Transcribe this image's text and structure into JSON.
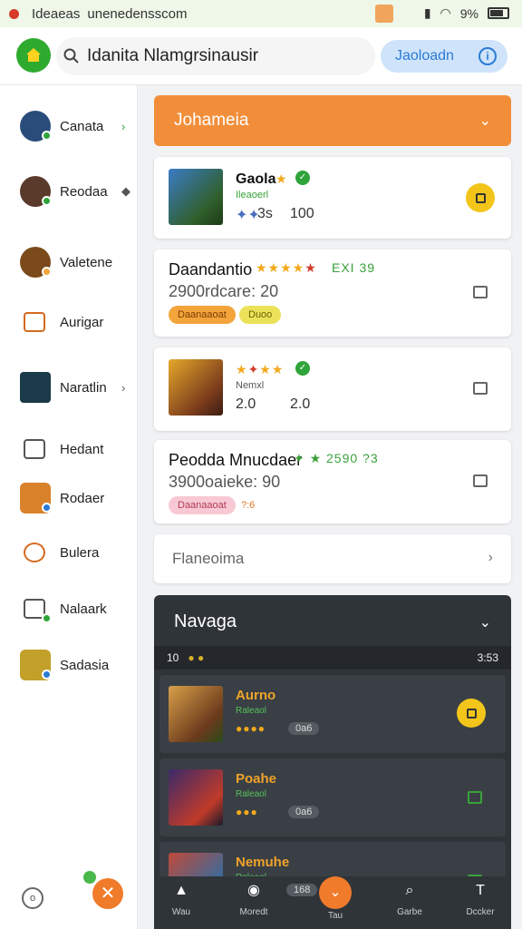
{
  "status_bar": {
    "left_text_1": "Ideaeas",
    "left_text_2": "unenedensscom",
    "right_text": "9%"
  },
  "top_bar": {
    "search_text": "Idanita Nlamgrsinausir",
    "pill_label": "Jaoloadn",
    "info_label": "i"
  },
  "sidebar": {
    "items": [
      {
        "label": "Canata",
        "has_chevron": true,
        "badge_color": "#2fa43a"
      },
      {
        "label": "Reodaa",
        "has_chevron": true,
        "badge_color": "#2fa43a"
      },
      {
        "label": "Valetene",
        "has_chevron": false,
        "badge_color": "#f3a43b"
      },
      {
        "label": "Aurigar",
        "has_chevron": false
      },
      {
        "label": "Naratlin",
        "has_chevron": true
      },
      {
        "label": "Hedant",
        "has_chevron": false
      },
      {
        "label": "Rodaer",
        "has_chevron": false,
        "badge_color": "#2b7bd6"
      },
      {
        "label": "Bulera",
        "has_chevron": false
      },
      {
        "label": "Nalaark",
        "has_chevron": false,
        "badge_color": "#2fa43a"
      },
      {
        "label": "Sadasia",
        "has_chevron": false,
        "badge_color": "#2b7bd6"
      }
    ]
  },
  "main": {
    "section_header": "Johameia",
    "cards": [
      {
        "title": "Gaola",
        "subtitle": "Ileaoerl",
        "meta_1": "3s",
        "meta_2": "100"
      },
      {
        "title": "Daandantio",
        "line": "2900rdcare: 20",
        "rating_text": "EXI 39",
        "tag_1": "Daanaaoat",
        "tag_2": "Duoo"
      },
      {
        "title": "",
        "subtitle": "Nemxl",
        "meta_1": "2.0",
        "meta_2": "2.0"
      },
      {
        "title": "Peodda Mnucdaer",
        "line": "3900oaieke: 90",
        "rating_text": "2590 ?3",
        "tag_1": "Daanaaoat",
        "tag_2": "?:6"
      }
    ],
    "plain_card": "Flaneoima",
    "dark_panel": {
      "title": "Navaga",
      "status_left": "10",
      "status_right": "3:53",
      "rows": [
        {
          "name": "Aurno",
          "sub": "Raleaol",
          "chip": "0a6"
        },
        {
          "name": "Poahe",
          "sub": "Raleaol",
          "chip": "0a6"
        },
        {
          "name": "Nemuhe",
          "sub": "Raleaol",
          "chip": "168"
        }
      ]
    }
  },
  "bottom_nav": {
    "items": [
      "Wau",
      "Moredt",
      "Tau",
      "Garbe",
      "Dccker"
    ],
    "chip": "168"
  }
}
